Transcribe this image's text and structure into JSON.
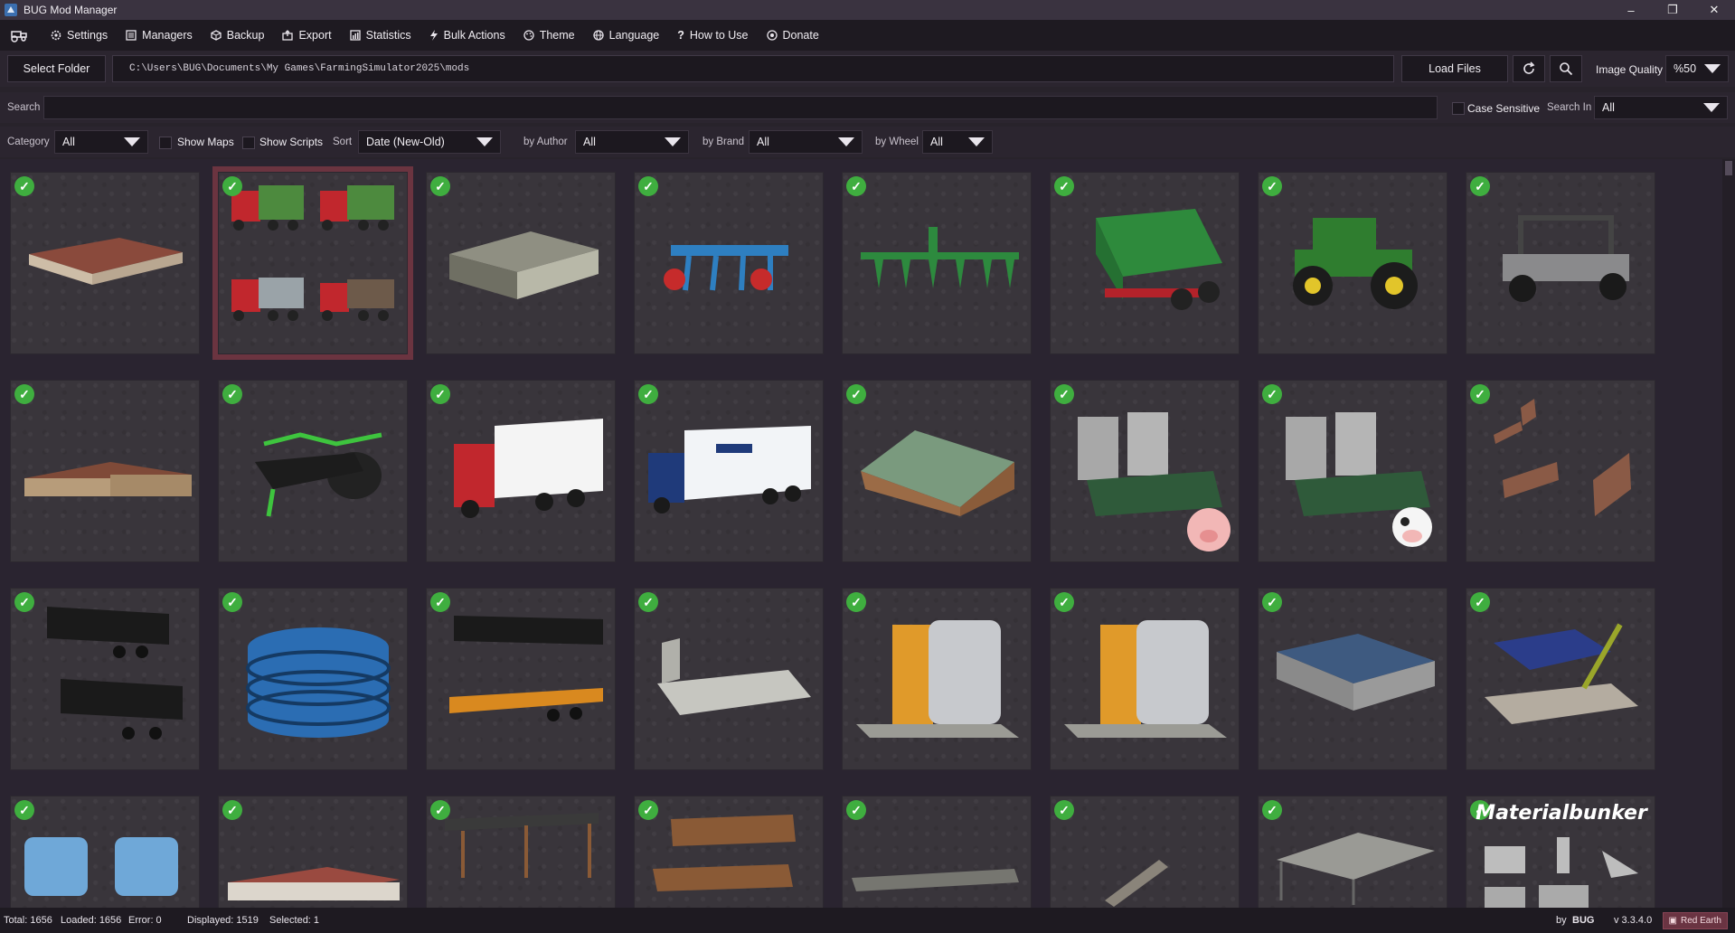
{
  "window": {
    "title": "BUG Mod Manager"
  },
  "menu": {
    "items": [
      {
        "label": "Settings",
        "icon": "gear-icon"
      },
      {
        "label": "Managers",
        "icon": "list-icon"
      },
      {
        "label": "Backup",
        "icon": "box-icon"
      },
      {
        "label": "Export",
        "icon": "export-icon"
      },
      {
        "label": "Statistics",
        "icon": "chart-icon"
      },
      {
        "label": "Bulk Actions",
        "icon": "bolt-icon"
      },
      {
        "label": "Theme",
        "icon": "palette-icon"
      },
      {
        "label": "Language",
        "icon": "globe-icon"
      },
      {
        "label": "How to Use",
        "icon": "question-icon"
      },
      {
        "label": "Donate",
        "icon": "donate-icon"
      }
    ]
  },
  "folder": {
    "select_label": "Select Folder",
    "path": "C:\\Users\\BUG\\Documents\\My Games\\FarmingSimulator2025\\mods",
    "load_label": "Load Files",
    "image_quality_label": "Image Quality",
    "image_quality_value": "%50"
  },
  "search": {
    "label": "Search",
    "value": "",
    "case_sensitive_label": "Case Sensitive",
    "search_in_label": "Search In",
    "search_in_value": "All"
  },
  "filters": {
    "category_label": "Category",
    "category_value": "All",
    "show_maps_label": "Show Maps",
    "show_scripts_label": "Show Scripts",
    "sort_label": "Sort",
    "sort_value": "Date (New-Old)",
    "author_label": "by Author",
    "author_value": "All",
    "brand_label": "by Brand",
    "brand_value": "All",
    "wheel_label": "by Wheel",
    "wheel_value": "All"
  },
  "card_text": {
    "materialbunker": "Materialbunker"
  },
  "status": {
    "total": "Total: 1656",
    "loaded": "Loaded: 1656",
    "error": "Error: 0",
    "displayed": "Displayed: 1519",
    "selected": "Selected: 1",
    "by": "by",
    "author": "BUG",
    "version": "v 3.3.4.0",
    "theme": "Red Earth"
  },
  "colors": {
    "accent": "#6b3440",
    "check": "#3fae3f",
    "background": "#28232b"
  }
}
